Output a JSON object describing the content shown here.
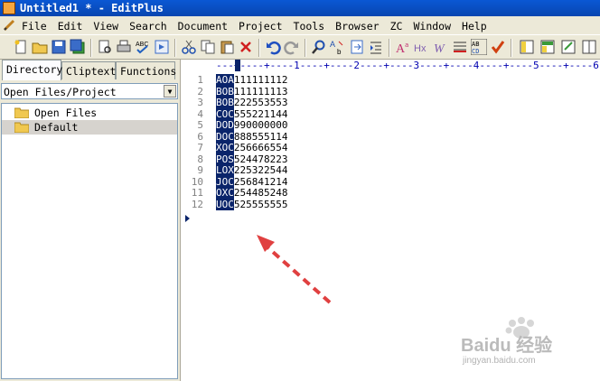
{
  "window": {
    "title": "Untitled1 * - EditPlus"
  },
  "menu": [
    "File",
    "Edit",
    "View",
    "Search",
    "Document",
    "Project",
    "Tools",
    "Browser",
    "ZC",
    "Window",
    "Help"
  ],
  "toolbar": {
    "icons": [
      "new-file-icon",
      "open-folder-icon",
      "save-icon",
      "save-all-icon",
      "print-preview-icon",
      "print-icon",
      "spell-check-icon",
      "check-icon",
      "browser-icon",
      "cut-icon",
      "copy-icon",
      "paste-icon",
      "delete-icon",
      "undo-icon",
      "redo-icon",
      "find-icon",
      "replace-icon",
      "goto-icon",
      "indent-icon",
      "font-size-icon",
      "hex-icon",
      "word-wrap-icon",
      "ruler-icon",
      "line-number-icon",
      "spell-icon",
      "view-left-icon",
      "view-center-icon",
      "view-right-icon",
      "view-split-icon"
    ]
  },
  "left_panel": {
    "tabs": [
      "Directory",
      "Cliptext",
      "Functions"
    ],
    "active_tab": "Directory",
    "selector_value": "Open Files/Project",
    "items": [
      "Open Files",
      "Default"
    ]
  },
  "editor": {
    "ruler": "---+----+----1----+----2----+----3----+----4----+----5----+----6",
    "lines": [
      {
        "num": "1",
        "sel": "AOA",
        "rest": "111111112"
      },
      {
        "num": "2",
        "sel": "BOB",
        "rest": "111111113"
      },
      {
        "num": "3",
        "sel": "BOB",
        "rest": "222553553"
      },
      {
        "num": "4",
        "sel": "COC",
        "rest": "555221144"
      },
      {
        "num": "5",
        "sel": "DOD",
        "rest": "990000000"
      },
      {
        "num": "6",
        "sel": "DOC",
        "rest": "888555114"
      },
      {
        "num": "7",
        "sel": "XOC",
        "rest": "256666554"
      },
      {
        "num": "8",
        "sel": "POS",
        "rest": "524478223"
      },
      {
        "num": "9",
        "sel": "LOX",
        "rest": "225322544"
      },
      {
        "num": "10",
        "sel": "JOC",
        "rest": "256841214"
      },
      {
        "num": "11",
        "sel": "OXC",
        "rest": "254485248"
      },
      {
        "num": "12",
        "sel": "UOC",
        "rest": "525555555"
      }
    ]
  },
  "watermark": {
    "brand": "Baidu 经验",
    "url": "jingyan.baidu.com"
  },
  "colors": {
    "titlebar": "#0846b0",
    "selection": "#0a246a",
    "arrow": "#e04040"
  }
}
